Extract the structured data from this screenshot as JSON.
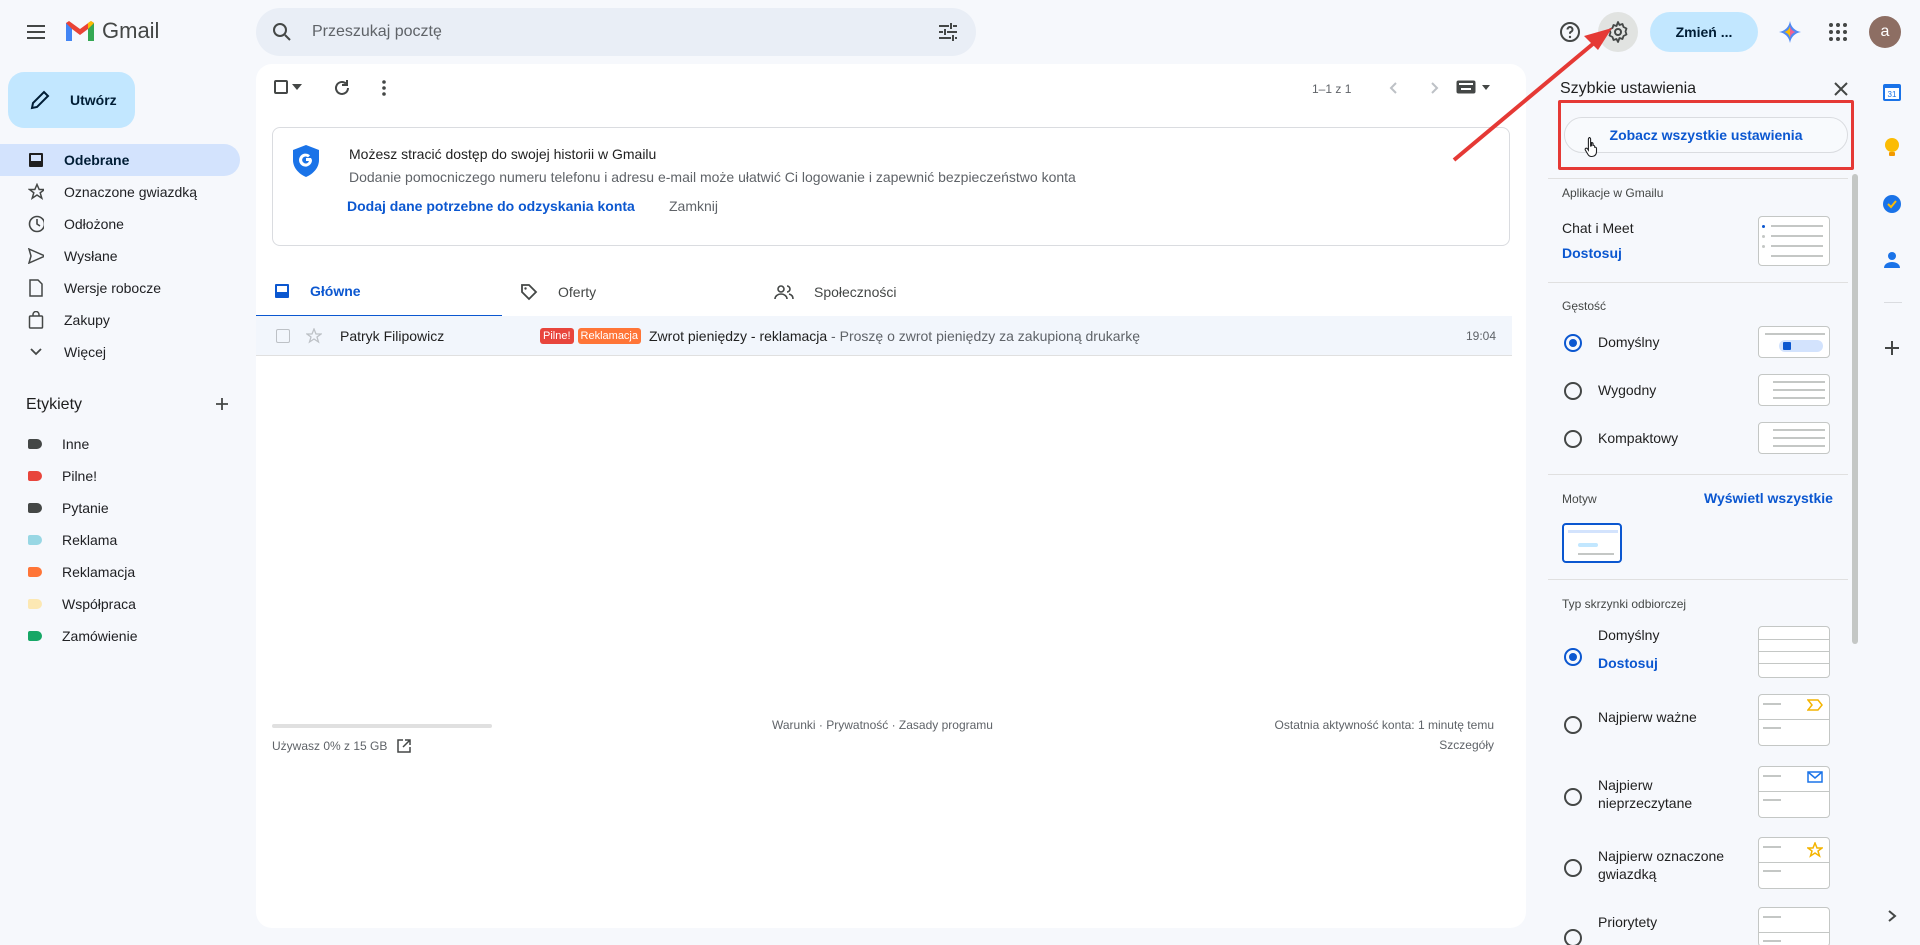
{
  "app": {
    "name": "Gmail"
  },
  "search": {
    "placeholder": "Przeszukaj pocztę"
  },
  "header": {
    "upgrade_label": "Zmień ...",
    "avatar_letter": "a"
  },
  "compose": {
    "label": "Utwórz"
  },
  "nav": {
    "items": [
      {
        "label": "Odebrane",
        "icon": "inbox-icon",
        "active": true
      },
      {
        "label": "Oznaczone gwiazdką",
        "icon": "star-icon"
      },
      {
        "label": "Odłożone",
        "icon": "clock-icon"
      },
      {
        "label": "Wysłane",
        "icon": "send-icon"
      },
      {
        "label": "Wersje robocze",
        "icon": "draft-icon"
      },
      {
        "label": "Zakupy",
        "icon": "shopping-bag-icon"
      },
      {
        "label": "Więcej",
        "icon": "chevron-down-icon"
      }
    ]
  },
  "labels": {
    "title": "Etykiety",
    "items": [
      {
        "label": "Inne",
        "color": "#444746"
      },
      {
        "label": "Pilne!",
        "color": "#e8453c"
      },
      {
        "label": "Pytanie",
        "color": "#444746"
      },
      {
        "label": "Reklama",
        "color": "#98d7e4"
      },
      {
        "label": "Reklamacja",
        "color": "#ff7537"
      },
      {
        "label": "Współpraca",
        "color": "#fce8b3"
      },
      {
        "label": "Zamówienie",
        "color": "#16a766"
      }
    ]
  },
  "toolbar": {
    "pagination": "1–1 z 1"
  },
  "banner": {
    "title": "Możesz stracić dostęp do swojej historii w Gmailu",
    "text": "Dodanie pomocniczego numeru telefonu i adresu e-mail może ułatwić Ci logowanie i zapewnić bezpieczeństwo konta",
    "action": "Dodaj dane potrzebne do odzyskania konta",
    "dismiss": "Zamknij"
  },
  "tabs": [
    {
      "label": "Główne",
      "icon": "inbox-icon",
      "active": true
    },
    {
      "label": "Oferty",
      "icon": "tag-icon"
    },
    {
      "label": "Społeczności",
      "icon": "people-icon"
    }
  ],
  "emails": [
    {
      "sender": "Patryk Filipowicz",
      "badges": [
        {
          "label": "Pilne!",
          "color": "#e8453c"
        },
        {
          "label": "Reklamacja",
          "color": "#ff7537"
        }
      ],
      "subject": "Zwrot pieniędzy - reklamacja",
      "snippet": " - Proszę o zwrot pieniędzy za zakupioną drukarkę",
      "time": "19:04"
    }
  ],
  "footer": {
    "storage": "Używasz 0% z 15 GB",
    "storage_used_percent": 0,
    "links": "Warunki · Prywatność · Zasady programu",
    "activity": "Ostatnia aktywność konta: 1 minutę temu",
    "details": "Szczegóły"
  },
  "quick_settings": {
    "title": "Szybkie ustawienia",
    "see_all": "Zobacz wszystkie ustawienia",
    "apps_title": "Aplikacje w Gmailu",
    "chat_meet": "Chat i Meet",
    "customize": "Dostosuj",
    "density_title": "Gęstość",
    "density_options": [
      {
        "label": "Domyślny",
        "selected": true
      },
      {
        "label": "Wygodny",
        "selected": false
      },
      {
        "label": "Kompaktowy",
        "selected": false
      }
    ],
    "theme_title": "Motyw",
    "theme_view_all": "Wyświetl wszystkie",
    "inbox_type_title": "Typ skrzynki odbiorczej",
    "inbox_options": [
      {
        "label": "Domyślny",
        "selected": true,
        "sub": "Dostosuj"
      },
      {
        "label": "Najpierw ważne",
        "selected": false
      },
      {
        "label": "Najpierw nieprzeczytane",
        "selected": false
      },
      {
        "label": "Najpierw oznaczone gwiazdką",
        "selected": false
      },
      {
        "label": "Priorytety",
        "selected": false
      }
    ]
  },
  "side_apps": [
    {
      "name": "calendar-icon",
      "text": "31",
      "color": "#1a73e8"
    },
    {
      "name": "keep-icon",
      "color": "#fbbc04"
    },
    {
      "name": "tasks-icon",
      "color": "#1a73e8"
    },
    {
      "name": "contacts-icon",
      "color": "#1a73e8"
    }
  ],
  "annotation": {
    "color": "#e53935"
  }
}
